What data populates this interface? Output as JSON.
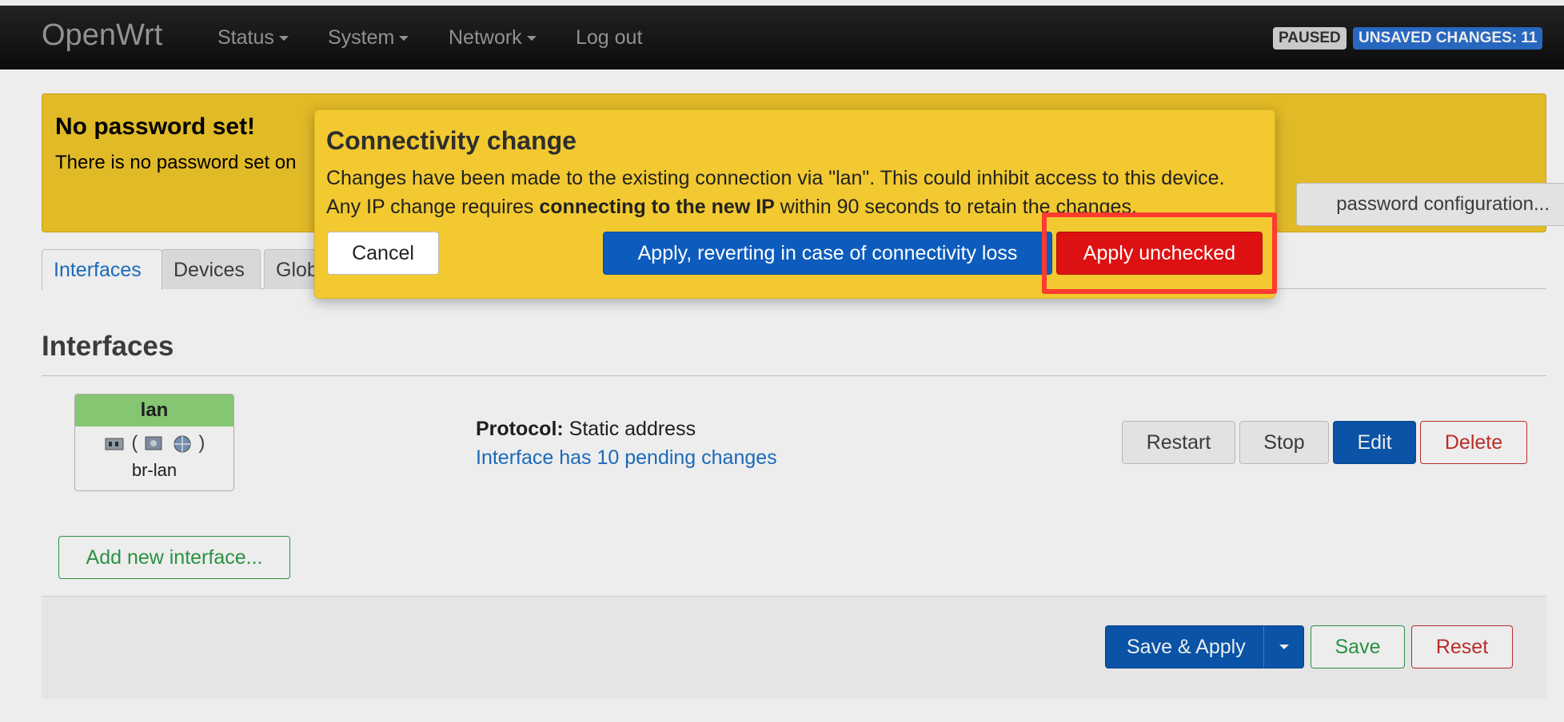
{
  "header": {
    "brand": "OpenWrt",
    "menu": [
      "Status",
      "System",
      "Network"
    ],
    "logout": "Log out",
    "badge_paused": "PAUSED",
    "badge_unsaved": "UNSAVED CHANGES: 11"
  },
  "alert": {
    "title": "No password set!",
    "text": "There is no password set on",
    "button": "password configuration..."
  },
  "tabs": [
    "Interfaces",
    "Devices",
    "Glob"
  ],
  "section": {
    "title": "Interfaces"
  },
  "interface": {
    "name": "lan",
    "icons_text": "(",
    "icons_text_close": ")",
    "device": "br-lan",
    "protocol_label": "Protocol:",
    "protocol_value": "Static address",
    "pending": "Interface has 10 pending changes",
    "buttons": {
      "restart": "Restart",
      "stop": "Stop",
      "edit": "Edit",
      "delete": "Delete"
    }
  },
  "add_interface": "Add new interface...",
  "footer": {
    "save_apply": "Save & Apply",
    "save": "Save",
    "reset": "Reset"
  },
  "modal": {
    "title": "Connectivity change",
    "line1": "Changes have been made to the existing connection via \"lan\". This could inhibit access to this device.",
    "line2_pre": "Any IP change requires ",
    "line2_bold": "connecting to the new IP",
    "line2_post": " within 90 seconds to retain the changes.",
    "cancel": "Cancel",
    "apply_revert": "Apply, reverting in case of connectivity loss",
    "apply_unchecked": "Apply unchecked"
  },
  "colors": {
    "warning": "#f2c930",
    "primary": "#0d5cbd",
    "danger": "#dd1111",
    "highlight": "#ff3b30"
  }
}
